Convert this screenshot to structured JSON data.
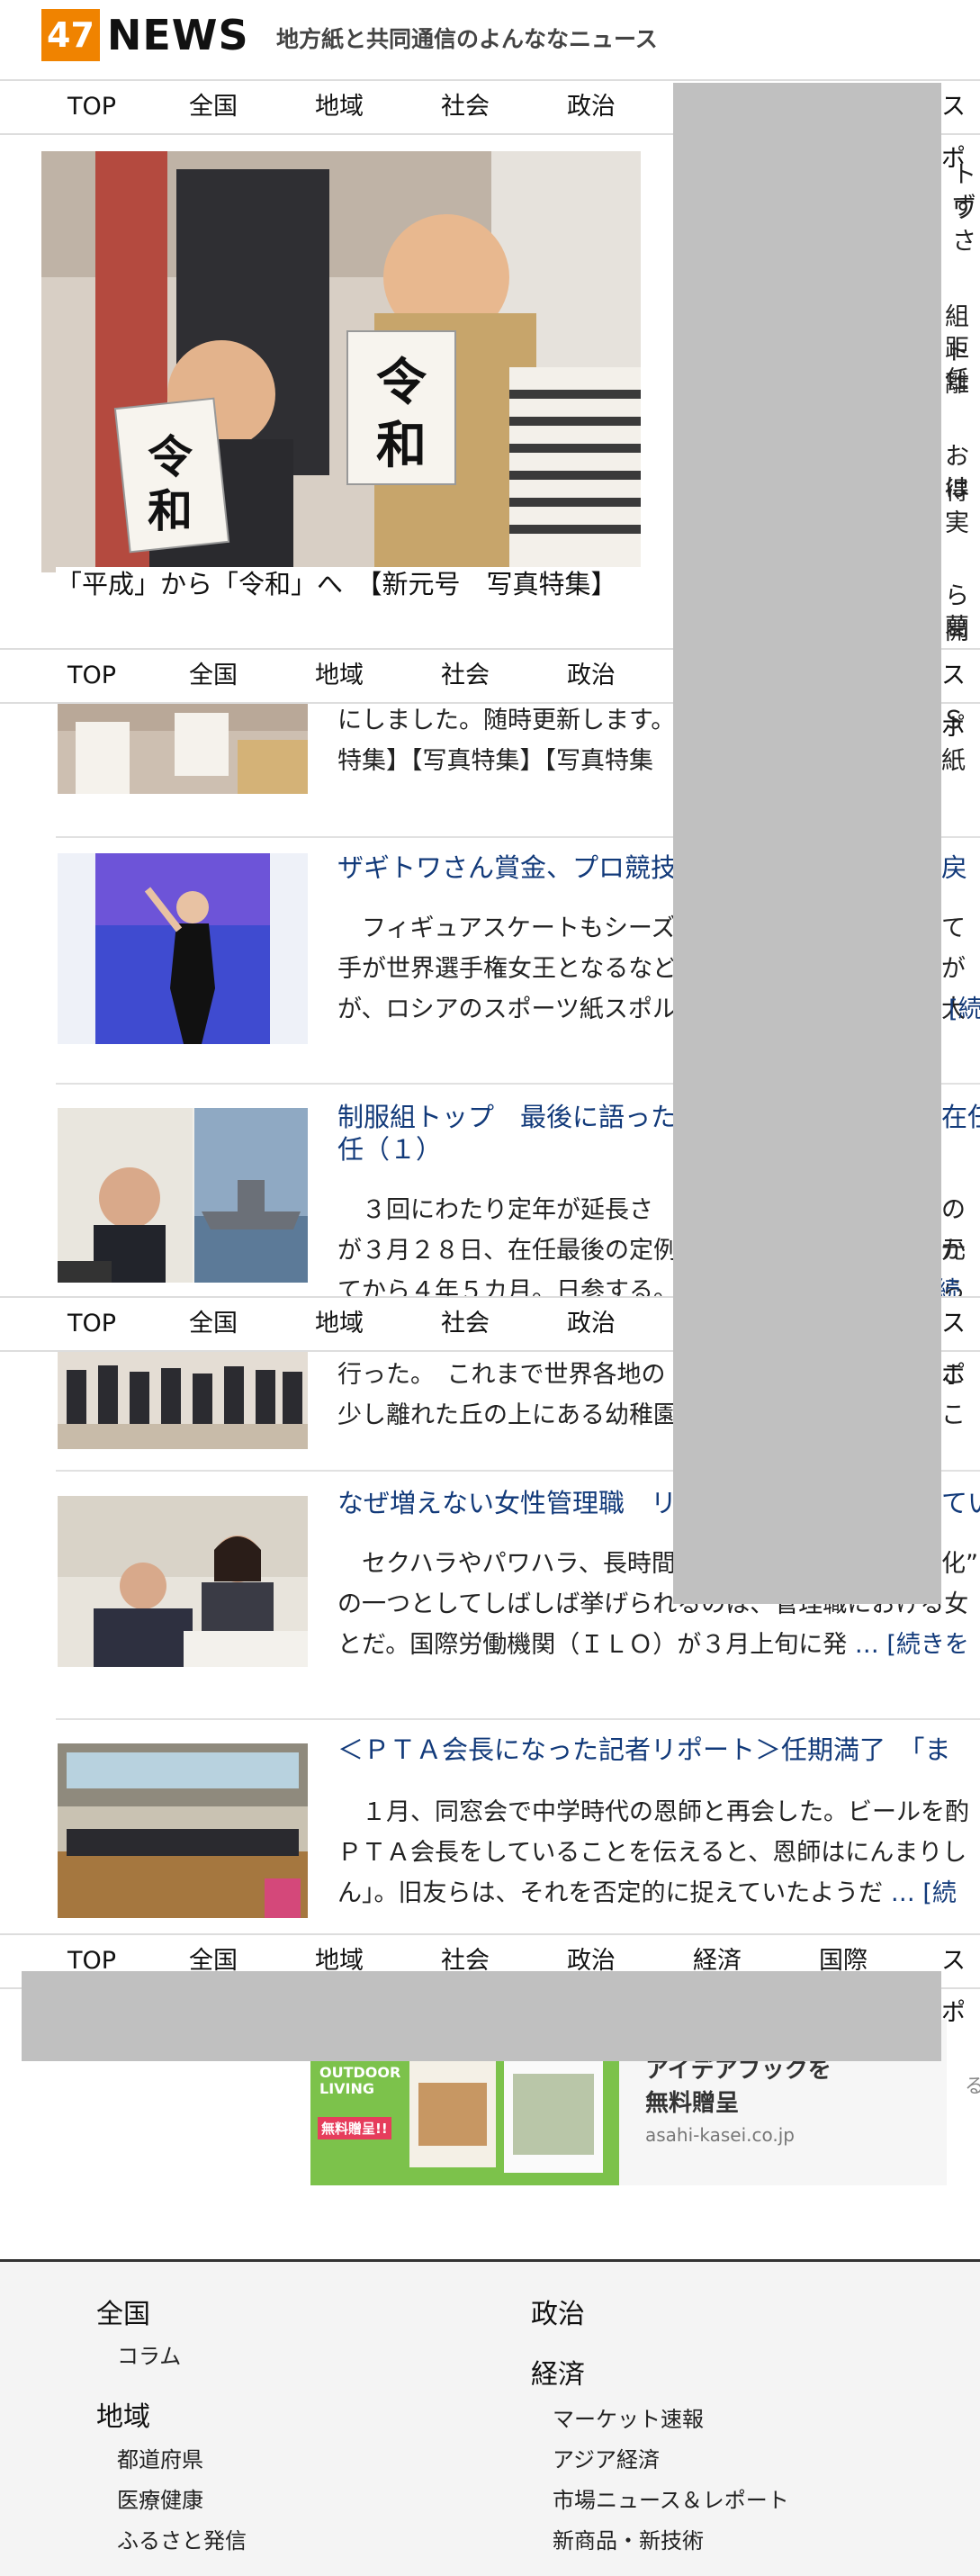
{
  "header": {
    "logo_number": "47",
    "logo_text": "NEWS",
    "tagline": "地方紙と共同通信のよんななニュース"
  },
  "nav": {
    "items": [
      "TOP",
      "全国",
      "地域",
      "社会",
      "政治",
      "経済",
      "国際",
      "スポ"
    ]
  },
  "hero": {
    "caption": "「平成」から「令和」へ　【新元号　写真特集】",
    "board_char_1": "令",
    "board_char_2": "和"
  },
  "peek": {
    "right_fragments": [
      "トワ",
      "ずさ",
      "組ト",
      "距離",
      "任",
      "お得",
      "は実",
      "ら開",
      "葛飾"
    ]
  },
  "articles": [
    {
      "title": "",
      "body_lines": [
        "にしました。随時更新します。",
        "特集】【写真特集】【写真特集"
      ],
      "body_right": "Ｓ紙",
      "more": ""
    },
    {
      "title": "ザギトワさん賞金、プロ競技",
      "title_right": "戻",
      "body_lines": [
        "　フィギュアスケートもシーズ",
        "手が世界選手権女王となるなど",
        "が、ロシアのスポーツ紙スポル"
      ],
      "body_right": [
        "て",
        "が大"
      ],
      "more": "[続"
    },
    {
      "title": "制服組トップ　最後に語った",
      "title_right": "在任",
      "title_line2": "任（１）",
      "body_lines": [
        "　３回にわたり定年が延長さ",
        "が３月２８日、在任最後の定例",
        "てから４年５カ月。日参する。"
      ],
      "body_right": [
        "の元",
        "から"
      ],
      "more": "続き"
    },
    {
      "title": "",
      "body_lines": [
        "行った。　これまで世界各地の",
        "少し離れた丘の上にある幼稚園"
      ],
      "body_right": "ここ",
      "more": ""
    },
    {
      "title": "なぜ増えない女性管理職　リ",
      "title_right": "てい",
      "body_lines": [
        "　セクハラやパワハラ、長時間",
        "の一つとしてしばしば挙げられるのは、管理職における女",
        "とだ。国際労働機関（ＩＬＯ）が３月上旬に発"
      ],
      "body_right": "化”",
      "more": "… [続きを"
    },
    {
      "title": "＜ＰＴＡ会長になった記者リポート＞任期満了　「ま",
      "body_lines": [
        "　１月、同窓会で中学時代の恩師と再会した。ビールを酌",
        "ＰＴＡ会長をしていることを伝えると、恩師はにんまりし",
        "ん」。旧友らは、それを否定的に捉えていたようだ"
      ],
      "more": "… [続"
    }
  ],
  "ad": {
    "title_line1": "アイデアブックを",
    "title_line2": "無料贈呈",
    "domain": "asahi-kasei.co.jp",
    "img_text_1": "OUTDOOR LIVING",
    "img_text_2": "無料贈呈!!",
    "clip": "る"
  },
  "footer": {
    "col1": {
      "heading1": "全国",
      "sub1": [
        "コラム"
      ],
      "heading2": "地域",
      "sub2": [
        "都道府県",
        "医療健康",
        "ふるさと発信"
      ]
    },
    "col2": {
      "heading1": "政治",
      "heading2": "経済",
      "sub2": [
        "マーケット速報",
        "アジア経済",
        "市場ニュース＆レポート",
        "新商品・新技術"
      ]
    }
  },
  "colors": {
    "brand_orange": "#f08300",
    "link_blue": "#123a7a",
    "overlay_gray": "#c0c0c0"
  }
}
